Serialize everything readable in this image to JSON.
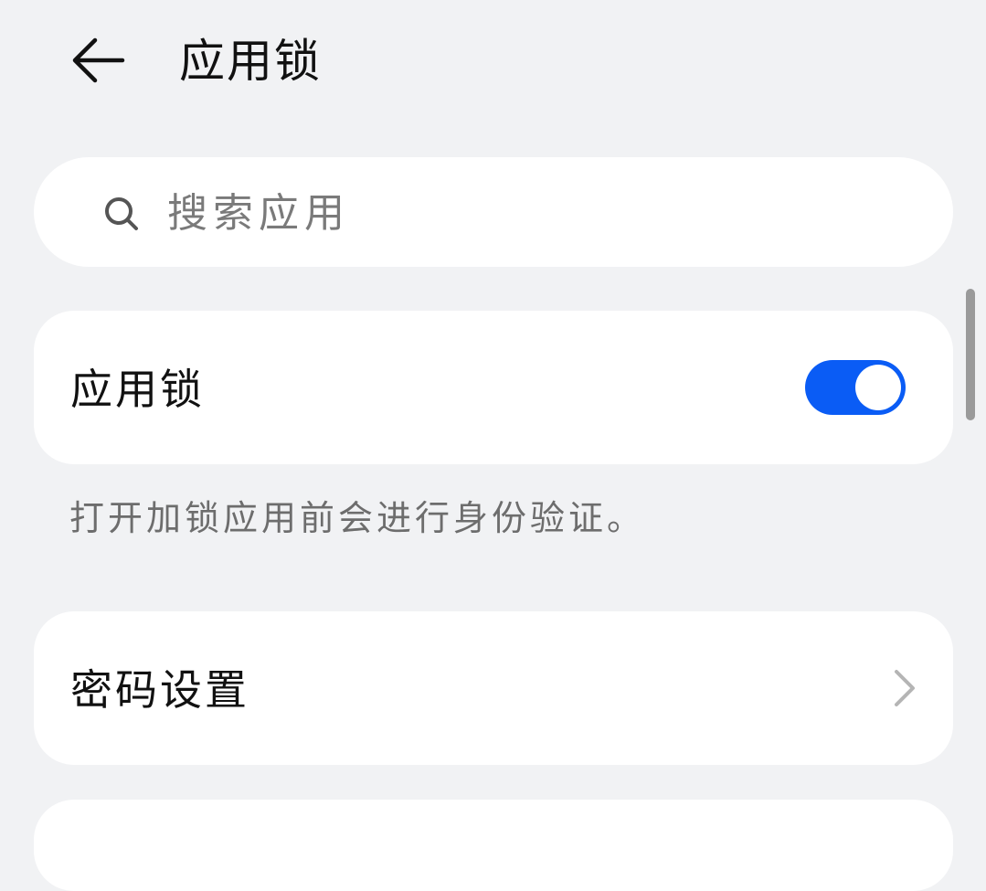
{
  "header": {
    "title": "应用锁",
    "back_icon": "arrow-left-icon"
  },
  "search": {
    "placeholder": "搜索应用",
    "value": "",
    "icon": "search-icon"
  },
  "app_lock_card": {
    "label": "应用锁",
    "toggle_on": true,
    "toggle_color": "#0a5cf5"
  },
  "hint": {
    "text": "打开加锁应用前会进行身份验证。"
  },
  "password_card": {
    "label": "密码设置",
    "icon": "chevron-right-icon"
  },
  "colors": {
    "background": "#f1f2f4",
    "card": "#ffffff",
    "accent": "#0a5cf5"
  }
}
